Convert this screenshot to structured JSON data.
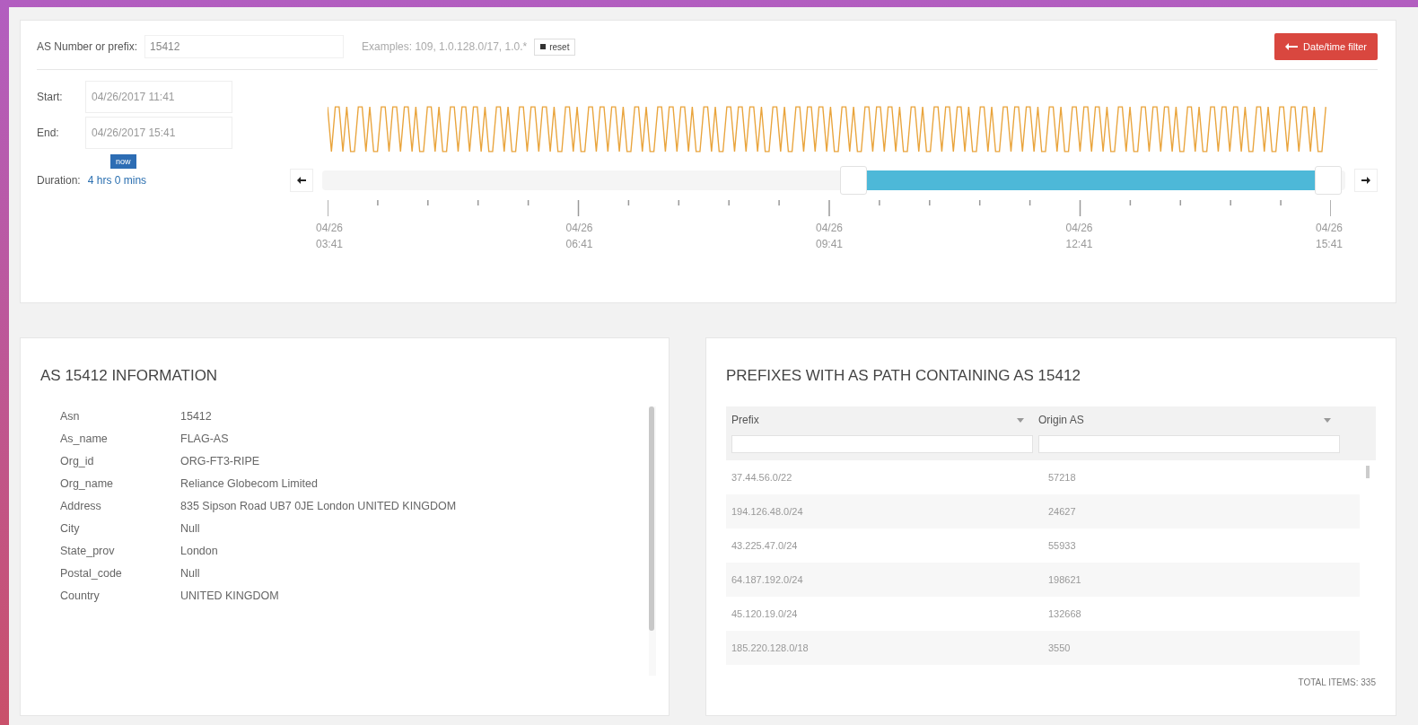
{
  "search": {
    "label": "AS Number or prefix:",
    "value": "15412",
    "examples": "Examples: 109, 1.0.128.0/17, 1.0.*",
    "reset_label": "reset"
  },
  "filter_button": "Date/time filter",
  "time": {
    "start_label": "Start:",
    "start_value": "04/26/2017 11:41",
    "end_label": "End:",
    "end_value": "04/26/2017 15:41",
    "now_label": "now",
    "duration_label": "Duration:",
    "duration_value": "4 hrs 0 mins"
  },
  "axis_labels": [
    {
      "date": "04/26",
      "time": "03:41"
    },
    {
      "date": "04/26",
      "time": "06:41"
    },
    {
      "date": "04/26",
      "time": "09:41"
    },
    {
      "date": "04/26",
      "time": "12:41"
    },
    {
      "date": "04/26",
      "time": "15:41"
    }
  ],
  "info": {
    "title": "AS 15412 INFORMATION",
    "rows": [
      {
        "key": "Asn",
        "value": "15412"
      },
      {
        "key": "As_name",
        "value": "FLAG-AS"
      },
      {
        "key": "Org_id",
        "value": "ORG-FT3-RIPE"
      },
      {
        "key": "Org_name",
        "value": "Reliance Globecom Limited"
      },
      {
        "key": "Address",
        "value": "835 Sipson Road UB7 0JE London UNITED KINGDOM"
      },
      {
        "key": "City",
        "value": "Null"
      },
      {
        "key": "State_prov",
        "value": "London"
      },
      {
        "key": "Postal_code",
        "value": "Null"
      },
      {
        "key": "Country",
        "value": "UNITED KINGDOM"
      }
    ]
  },
  "prefixes": {
    "title": "PREFIXES WITH AS PATH CONTAINING AS 15412",
    "columns": [
      "Prefix",
      "Origin AS"
    ],
    "rows": [
      [
        "37.44.56.0/22",
        "57218"
      ],
      [
        "194.126.48.0/24",
        "24627"
      ],
      [
        "43.225.47.0/24",
        "55933"
      ],
      [
        "64.187.192.0/24",
        "198621"
      ],
      [
        "45.120.19.0/24",
        "132668"
      ],
      [
        "185.220.128.0/18",
        "3550"
      ]
    ],
    "total": "TOTAL ITEMS: 335"
  }
}
